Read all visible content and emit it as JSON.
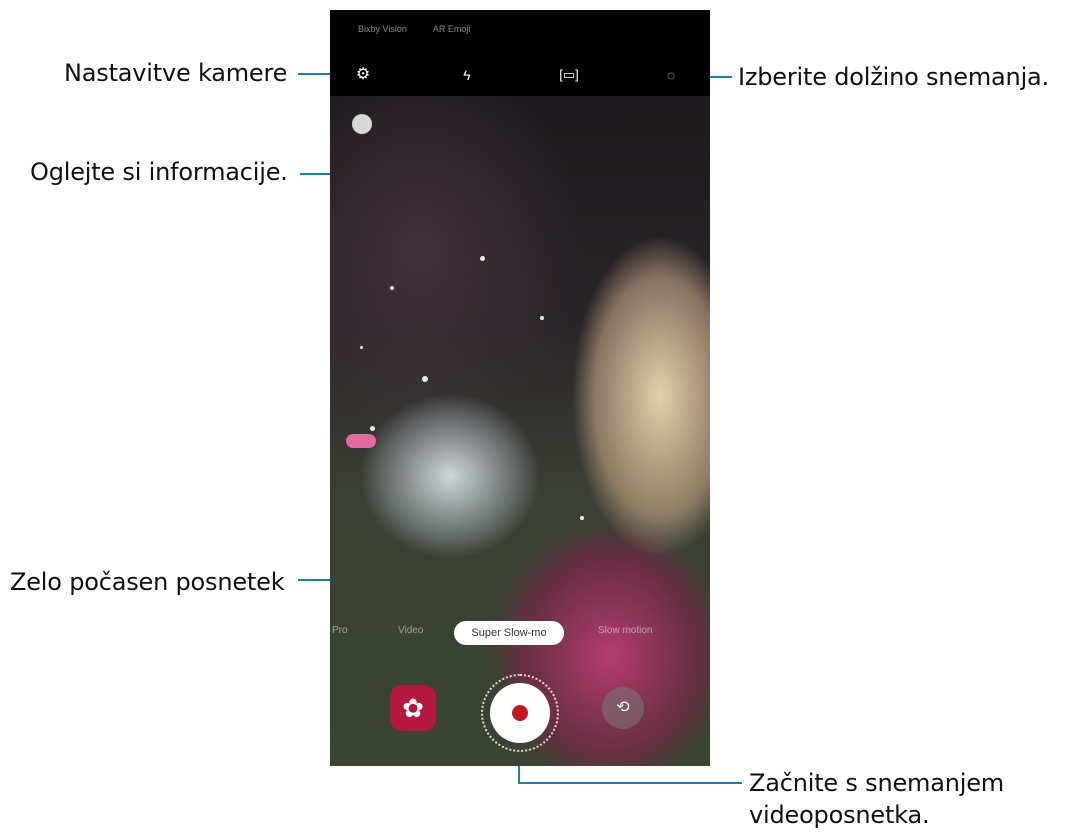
{
  "callouts": {
    "camera_settings": "Nastavitve kamere",
    "view_info": "Oglejte si informacije.",
    "recording_length": "Izberite dolžino snemanja.",
    "super_slow": "Zelo počasen posnetek",
    "start_recording_line1": "Začnite s snemanjem",
    "start_recording_line2": "videoposnetka."
  },
  "camera": {
    "top_modes": [
      "Bixby Vision",
      "AR Emoji"
    ],
    "icons": {
      "settings": "gear-icon",
      "flash": "flash-off-icon",
      "detect": "auto-detect-icon",
      "length": "recording-length-icon"
    },
    "mode_strip": {
      "left_faded": [
        "Pro",
        "Video"
      ],
      "selected": "Super Slow-mo",
      "right_faded": "Slow motion"
    },
    "bottom": {
      "gallery": "gallery-icon",
      "record": "record-icon",
      "switch": "switch-camera-icon"
    }
  },
  "colors": {
    "callout_line": "#1a7fb5",
    "record_dot": "#c2191f",
    "gallery_bg": "#b5163d"
  }
}
